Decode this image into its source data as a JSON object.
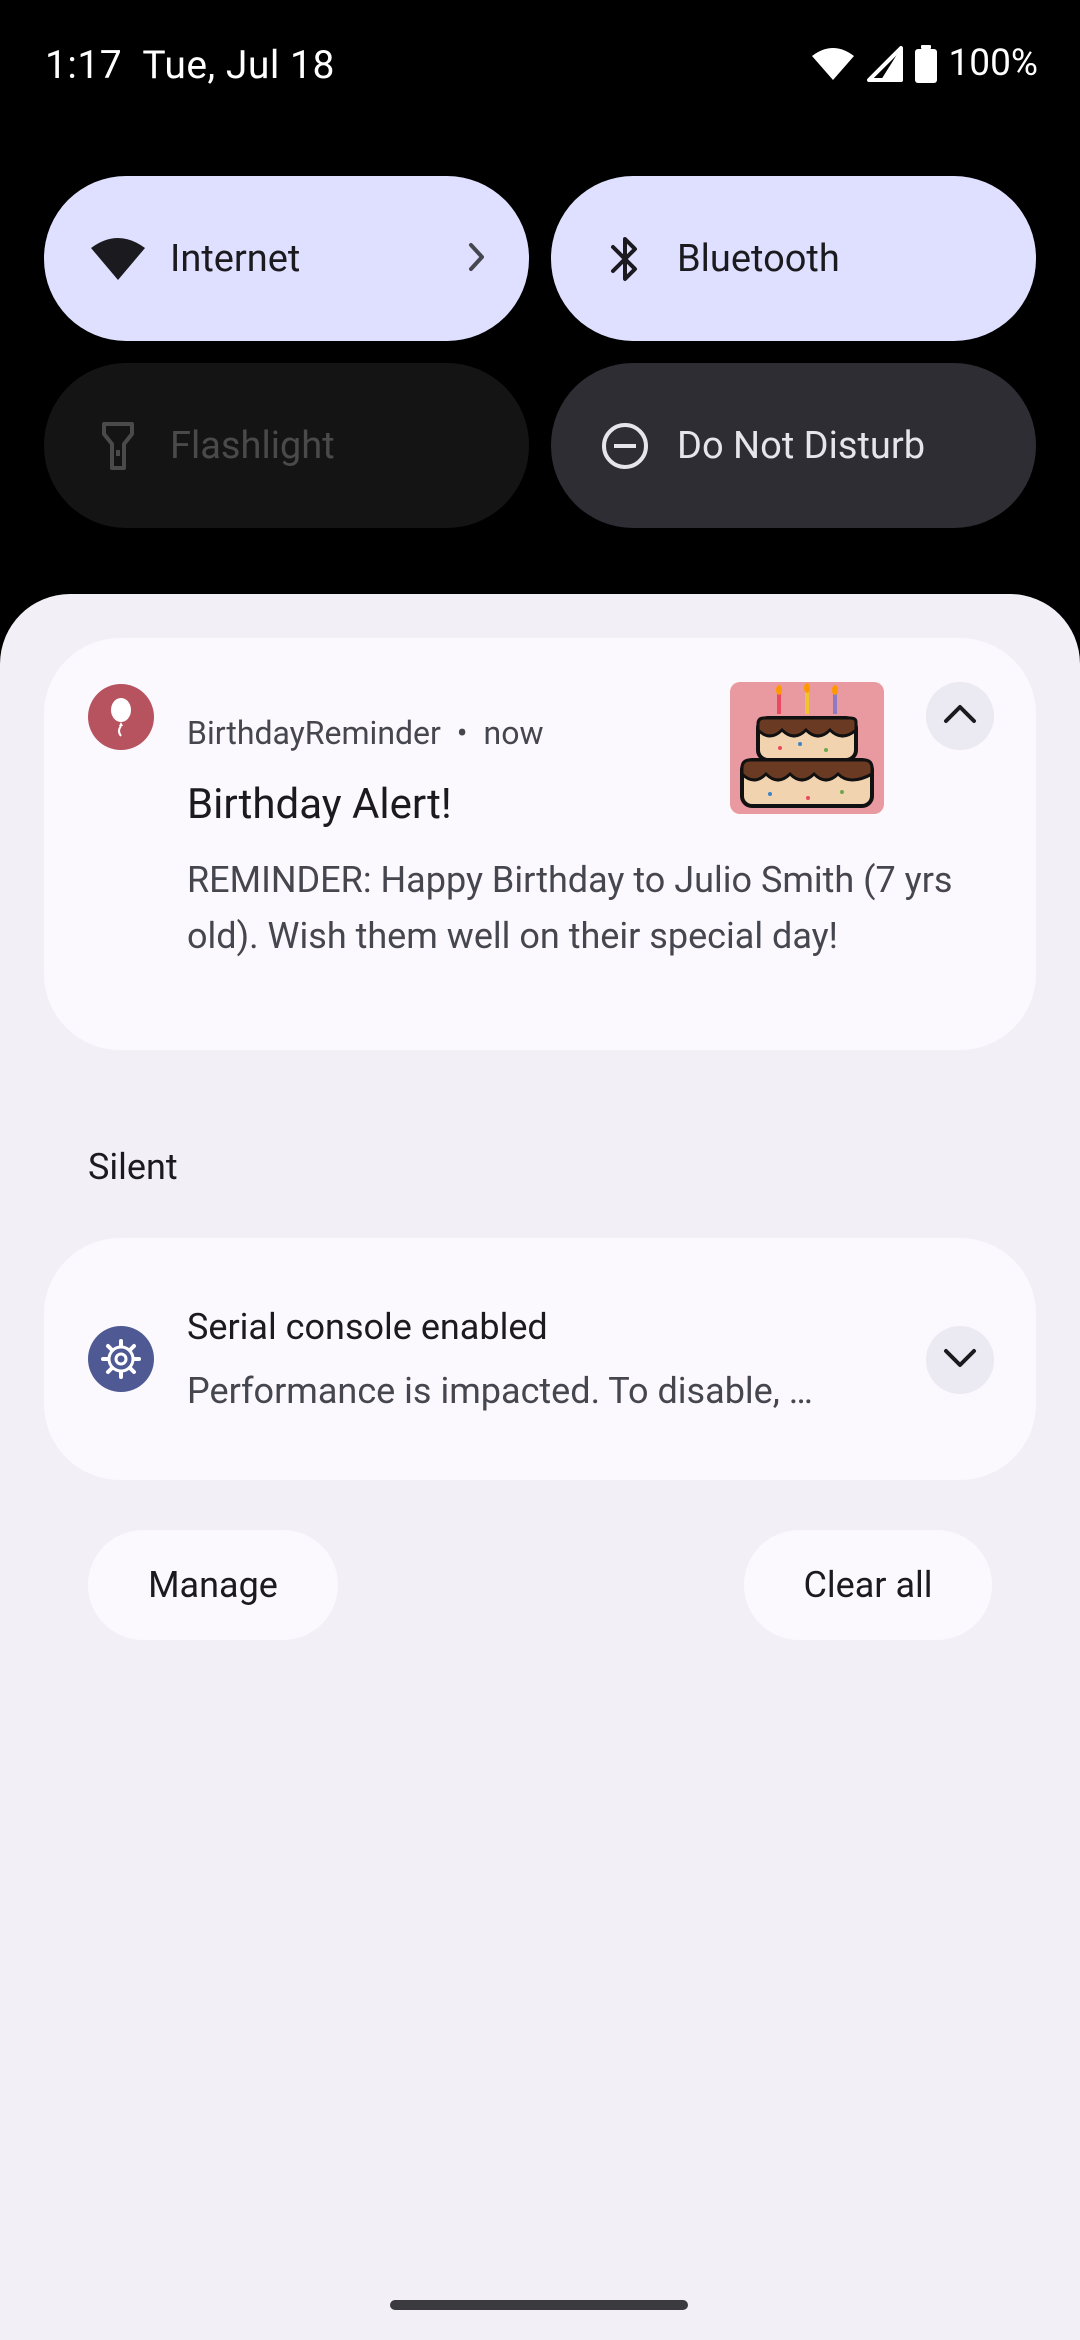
{
  "status_bar": {
    "time": "1:17",
    "date": "Tue, Jul 18",
    "battery": "100%",
    "icons": [
      "wifi-icon",
      "cell-signal-icon",
      "battery-icon"
    ]
  },
  "quick_settings": {
    "tiles": [
      {
        "label": "Internet",
        "icon": "wifi-icon",
        "state": "on"
      },
      {
        "label": "Bluetooth",
        "icon": "bluetooth-icon",
        "state": "on"
      },
      {
        "label": "Flashlight",
        "icon": "flashlight-icon",
        "state": "unavailable"
      },
      {
        "label": "Do Not Disturb",
        "icon": "do-not-disturb-icon",
        "state": "off"
      }
    ]
  },
  "notifications": {
    "birthday": {
      "app": "BirthdayReminder",
      "time": "now",
      "separator": "•",
      "title": "Birthday Alert!",
      "text": "REMINDER: Happy Birthday to Julio Smith (7 yrs old). Wish them well on their special day!",
      "icon": "balloon-icon",
      "thumbnail": "birthday-cake-image",
      "app_color": "#b6535f"
    },
    "silent_header": "Silent",
    "serial": {
      "title": "Serial console enabled",
      "text": "Performance is impacted. To disable, …",
      "icon": "gear-icon",
      "app_color": "#4f5993"
    }
  },
  "actions": {
    "manage": "Manage",
    "clear_all": "Clear all"
  },
  "colors": {
    "tile_on": "#dfe0ff",
    "tile_dark": "#2e2d33",
    "shade_bg": "#f2f0f6",
    "card_bg": "#fbf8fe"
  }
}
